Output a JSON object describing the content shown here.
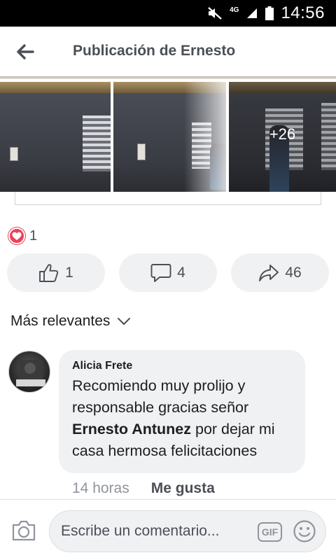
{
  "status_bar": {
    "network": "4G",
    "time": "14:56"
  },
  "header": {
    "title": "Publicación de Ernesto"
  },
  "photos": {
    "more_count": "+26"
  },
  "reactions": {
    "count": "1",
    "like_count": "1",
    "comment_count": "4",
    "share_count": "46"
  },
  "sort": {
    "label": "Más relevantes"
  },
  "comment": {
    "author": "Alicia Frete",
    "text_before": "Recomiendo muy prolijo y responsable gracias señor ",
    "mention": "Ernesto Antunez",
    "text_after": " por dejar mi casa hermosa felicitaciones",
    "time": "14 horas",
    "like_label": "Me gusta"
  },
  "composer": {
    "placeholder": "Escribe un comentario...",
    "gif_label": "GIF"
  },
  "colors": {
    "heart": "#e8445a",
    "pill_bg": "#f0f1f3",
    "secondary_text": "#4b4f56"
  }
}
